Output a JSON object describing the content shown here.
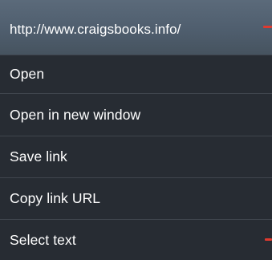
{
  "context_menu": {
    "url": "http://www.craigsbooks.info/",
    "items": [
      {
        "label": "Open"
      },
      {
        "label": "Open in new window"
      },
      {
        "label": "Save link"
      },
      {
        "label": "Copy link URL"
      },
      {
        "label": "Select text"
      }
    ]
  },
  "colors": {
    "background": "#272c33",
    "header": "#4f5e6e",
    "divider": "#3f454d",
    "text": "#ffffff",
    "annotation_marker": "#e03a2f"
  }
}
